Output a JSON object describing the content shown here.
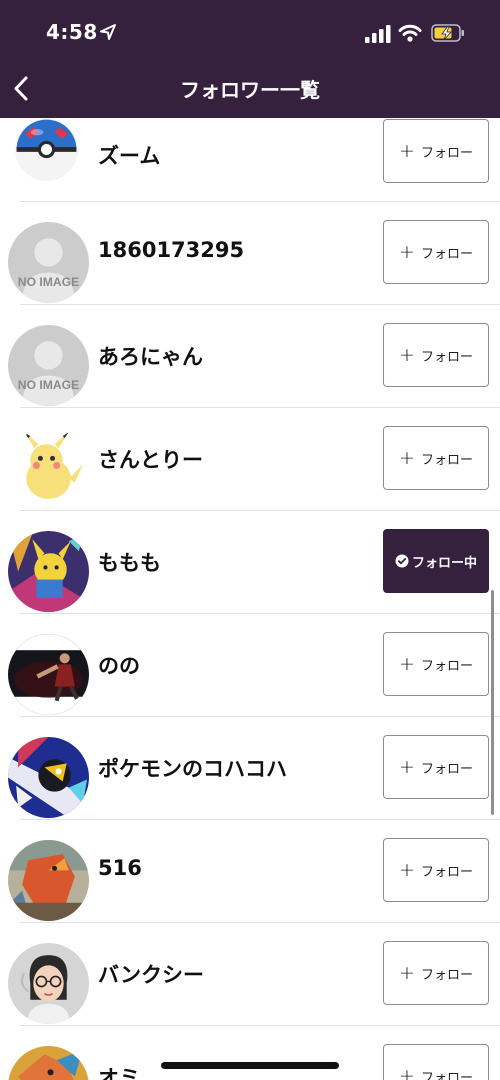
{
  "status_bar": {
    "time": "4:58"
  },
  "header": {
    "title": "フォロワー一覧"
  },
  "follow_label": "フォロー",
  "following_label": "フォロー中",
  "users": [
    {
      "name": "ズーム",
      "avatar": "pokeball-avatar",
      "following": false
    },
    {
      "name": "1860173295",
      "avatar": "no-image-avatar",
      "following": false,
      "avatar_text": "NO IMAGE"
    },
    {
      "name": "あろにゃん",
      "avatar": "no-image-avatar",
      "following": false,
      "avatar_text": "NO IMAGE"
    },
    {
      "name": "さんとりー",
      "avatar": "pikachu-avatar",
      "following": false
    },
    {
      "name": "ももも",
      "avatar": "pikachu-art-avatar",
      "following": true
    },
    {
      "name": "のの",
      "avatar": "performer-photo-avatar",
      "following": false
    },
    {
      "name": "ポケモンのコハコハ",
      "avatar": "pokemon-art-avatar",
      "following": false
    },
    {
      "name": "516",
      "avatar": "charizard-card-avatar",
      "following": false
    },
    {
      "name": "バンクシー",
      "avatar": "cartoon-person-avatar",
      "following": false
    },
    {
      "name": "オミ",
      "avatar": "charizard-avatar",
      "following": false
    }
  ],
  "colors": {
    "header_bg": "#35213d",
    "following_bg": "#35213d"
  }
}
